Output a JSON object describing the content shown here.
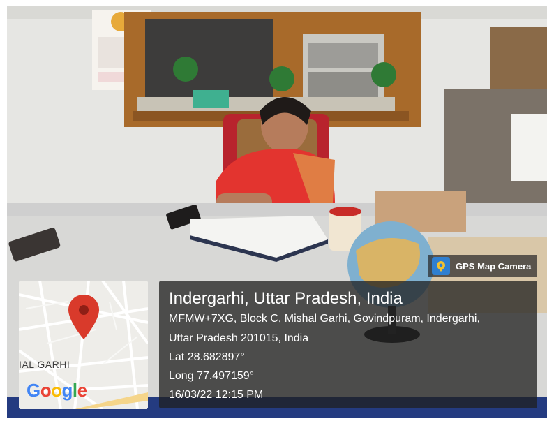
{
  "overlay": {
    "app_label": "GPS Map Camera",
    "app_icon": "gps-map-camera-icon",
    "map": {
      "place_label": "IAL GARHI",
      "logo_letters": [
        {
          "char": "G",
          "color": "#4285F4"
        },
        {
          "char": "o",
          "color": "#EA4335"
        },
        {
          "char": "o",
          "color": "#FBBC05"
        },
        {
          "char": "g",
          "color": "#4285F4"
        },
        {
          "char": "l",
          "color": "#34A853"
        },
        {
          "char": "e",
          "color": "#EA4335"
        }
      ],
      "pin_color": "#D93A2B"
    },
    "location_title": "Indergarhi, Uttar Pradesh, India",
    "address_line1": "MFMW+7XG, Block C, Mishal Garhi, Govindpuram, Indergarhi,",
    "address_line2": "Uttar Pradesh 201015, India",
    "latitude": "Lat 28.682897°",
    "longitude": "Long 77.497159°",
    "timestamp": "16/03/22 12:15 PM"
  },
  "photo": {
    "description_icon": "office-desk-photo"
  }
}
